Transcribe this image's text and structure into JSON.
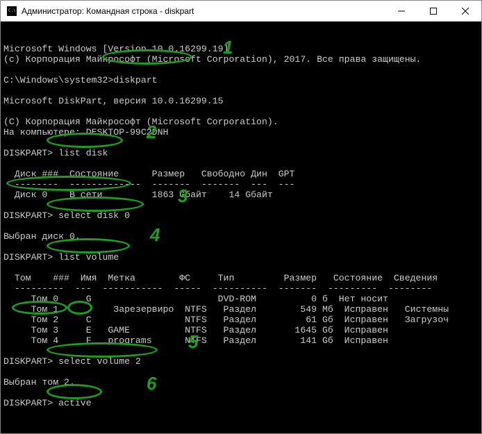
{
  "window": {
    "title": "Администратор: Командная строка - diskpart"
  },
  "lines": {
    "l0": "Microsoft Windows [Version 10.0.16299.19]",
    "l1": "(c) Корпорация Майкрософт (Microsoft Corporation), 2017. Все права защищены.",
    "l2": "",
    "l3a": "C:\\Windows\\system32>",
    "l3b": "diskpart",
    "l4": "",
    "l5": "Microsoft DiskPart, версия 10.0.16299.15",
    "l6": "",
    "l7": "(C) Корпорация Майкрософт (Microsoft Corporation).",
    "l8": "На компьютере: DESKTOP-99C2DNH",
    "l9": "",
    "l10a": "DISKPART> ",
    "l10b": "list disk",
    "l11": "",
    "l12": "  Диск ###  Состояние      Размер   Свободно Дин  GPT",
    "l13": "  --------  -------------  -------  -------  ---  ---",
    "l14": "  Диск 0    В сети         1863 Gбайт    14 Gбайт",
    "l15": "",
    "l16a": "DISKPART> ",
    "l16b": "select disk 0",
    "l17": "",
    "l18": "Выбран диск 0.",
    "l19": "",
    "l20a": "DISKPART> ",
    "l20b": "list volume",
    "l21": "",
    "l22": "  Том    ###  Имя  Метка        ФС     Тип         Размер   Состояние  Сведения",
    "l23": "  ---------  ---  -----------  -----  ----------  -------  ---------  --------",
    "l24": "     Том 0     G                       DVD-ROM          0 б  Нет носит",
    "l25": "     Том 1          Зарезервиро  NTFS   Раздел        549 Мб  Исправен   Системны",
    "l26": "     Том 2     C                 NTFS   Раздел         61 Gб  Исправен   Загрузоч",
    "l27": "     Том 3     E   GAME          NTFS   Раздел       1645 Gб  Исправен",
    "l28": "     Том 4     F   programs      NTFS   Раздел        141 Gб  Исправен",
    "l29": "",
    "l30a": "DISKPART> ",
    "l30b": "select volume 2",
    "l31": "",
    "l32": "Выбран том 2.",
    "l33": "",
    "l34a": "DISKPART> ",
    "l34b": "active",
    "l35": ""
  },
  "annotations": {
    "n1": "1",
    "n2": "2",
    "n3": "3",
    "n4": "4",
    "n5": "5",
    "n6": "6"
  }
}
